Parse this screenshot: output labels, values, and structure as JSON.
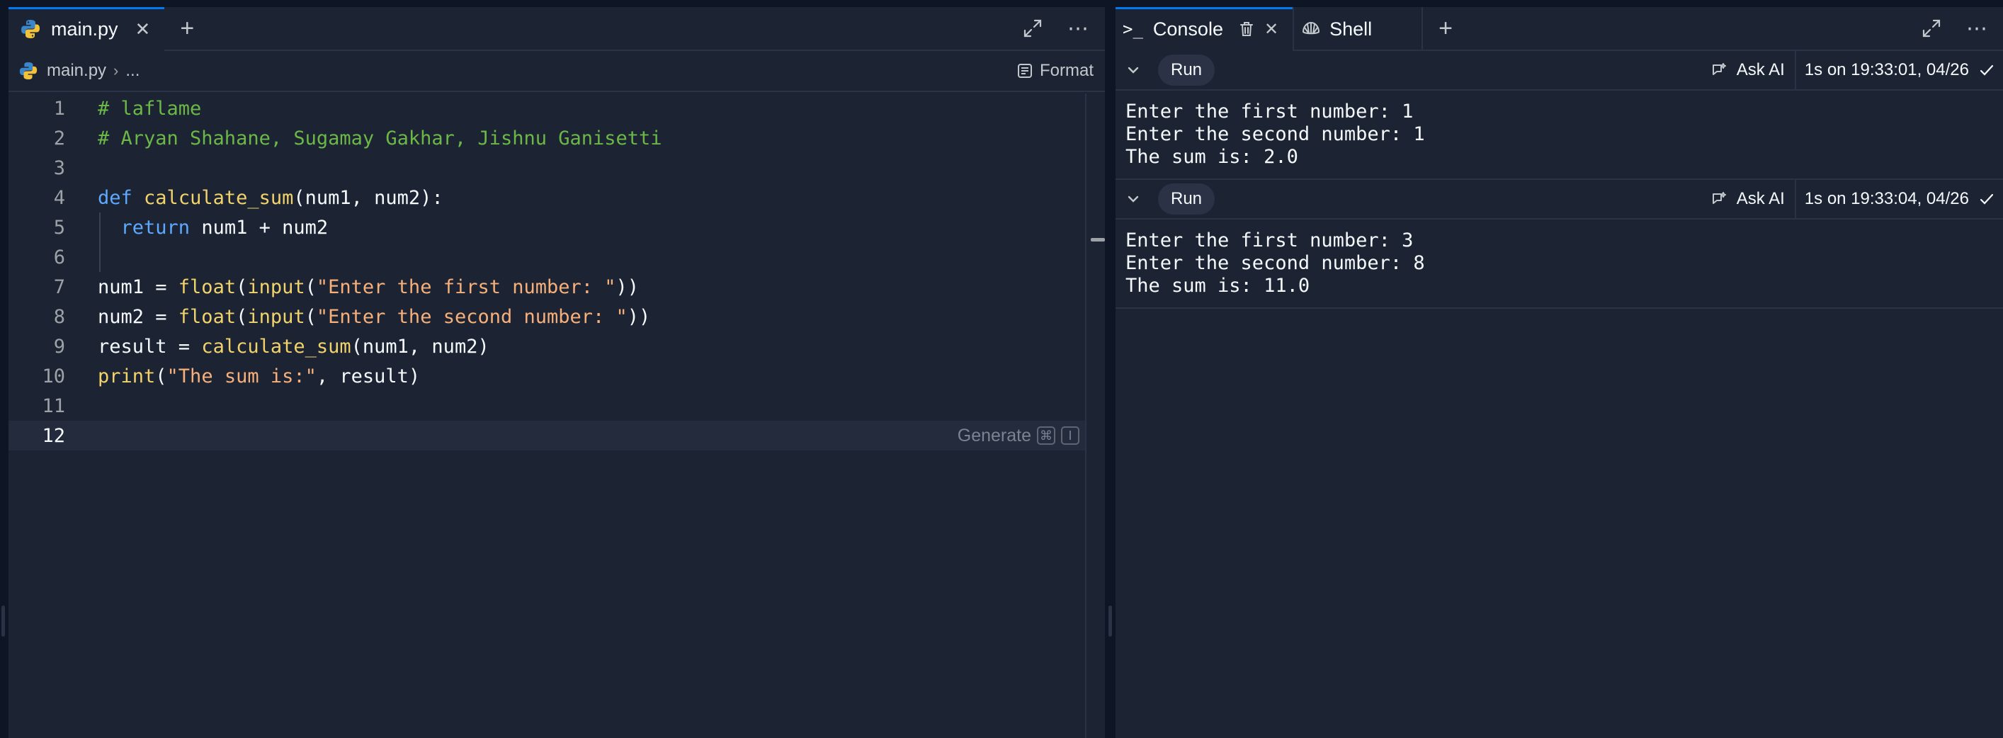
{
  "editor": {
    "tab_label": "main.py",
    "breadcrumb_file": "main.py",
    "breadcrumb_more": "...",
    "format_label": "Format",
    "generate_label": "Generate",
    "generate_key1": "⌘",
    "generate_key2": "I",
    "lines": [
      {
        "n": "1",
        "tokens": [
          {
            "t": "# laflame",
            "c": "comment"
          }
        ]
      },
      {
        "n": "2",
        "tokens": [
          {
            "t": "# Aryan Shahane, Sugamay Gakhar, Jishnu Ganisetti",
            "c": "comment"
          }
        ]
      },
      {
        "n": "3",
        "tokens": []
      },
      {
        "n": "4",
        "tokens": [
          {
            "t": "def",
            "c": "kw"
          },
          {
            "t": " ",
            "c": ""
          },
          {
            "t": "calculate_sum",
            "c": "fn"
          },
          {
            "t": "(num1, num2):",
            "c": ""
          }
        ]
      },
      {
        "n": "5",
        "tokens": [
          {
            "t": "  ",
            "c": ""
          },
          {
            "t": "return",
            "c": "kw"
          },
          {
            "t": " num1 + num2",
            "c": ""
          }
        ]
      },
      {
        "n": "6",
        "tokens": []
      },
      {
        "n": "7",
        "tokens": [
          {
            "t": "num1 = ",
            "c": ""
          },
          {
            "t": "float",
            "c": "fn"
          },
          {
            "t": "(",
            "c": ""
          },
          {
            "t": "input",
            "c": "fn"
          },
          {
            "t": "(",
            "c": ""
          },
          {
            "t": "\"Enter the first number: \"",
            "c": "str"
          },
          {
            "t": "))",
            "c": ""
          }
        ]
      },
      {
        "n": "8",
        "tokens": [
          {
            "t": "num2 = ",
            "c": ""
          },
          {
            "t": "float",
            "c": "fn"
          },
          {
            "t": "(",
            "c": ""
          },
          {
            "t": "input",
            "c": "fn"
          },
          {
            "t": "(",
            "c": ""
          },
          {
            "t": "\"Enter the second number: \"",
            "c": "str"
          },
          {
            "t": "))",
            "c": ""
          }
        ]
      },
      {
        "n": "9",
        "tokens": [
          {
            "t": "result = ",
            "c": ""
          },
          {
            "t": "calculate_sum",
            "c": "fn"
          },
          {
            "t": "(num1, num2)",
            "c": ""
          }
        ]
      },
      {
        "n": "10",
        "tokens": [
          {
            "t": "print",
            "c": "fn"
          },
          {
            "t": "(",
            "c": ""
          },
          {
            "t": "\"The sum is:\"",
            "c": "str"
          },
          {
            "t": ", result)",
            "c": ""
          }
        ]
      },
      {
        "n": "11",
        "tokens": []
      },
      {
        "n": "12",
        "tokens": []
      }
    ]
  },
  "console": {
    "tab_console": "Console",
    "tab_shell": "Shell",
    "runs": [
      {
        "run_label": "Run",
        "ask_ai": "Ask AI",
        "timing": "1s on 19:33:01, 04/26",
        "output": [
          "Enter the first number: 1",
          "Enter the second number: 1",
          "The sum is: 2.0"
        ]
      },
      {
        "run_label": "Run",
        "ask_ai": "Ask AI",
        "timing": "1s on 19:33:04, 04/26",
        "output": [
          "Enter the first number: 3",
          "Enter the second number: 8",
          "The sum is: 11.0"
        ]
      }
    ]
  },
  "colors": {
    "background": "#0e1525",
    "pane": "#1c2333",
    "accent": "#0079f2",
    "comment": "#6cb847",
    "keyword": "#5da9ff",
    "function": "#f2d36b",
    "string": "#f7b07a"
  }
}
